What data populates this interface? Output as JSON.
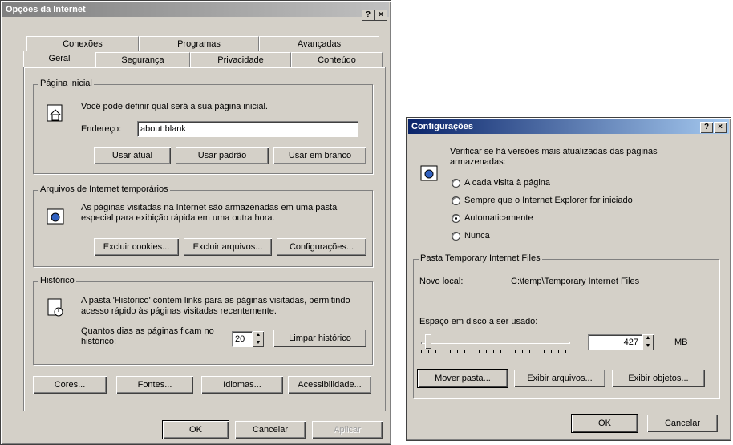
{
  "left_window": {
    "title": "Opções da Internet",
    "title_help": "?",
    "title_close": "×",
    "tabs_row1": [
      "Conexões",
      "Programas",
      "Avançadas"
    ],
    "tabs_row2": [
      "Geral",
      "Segurança",
      "Privacidade",
      "Conteúdo"
    ],
    "home": {
      "label": "Página inicial",
      "desc": "Você pode definir qual será a sua página inicial.",
      "address_label": "Endereço:",
      "address_value": "about:blank",
      "btn_current": "Usar atual",
      "btn_default": "Usar padrão",
      "btn_blank": "Usar em branco"
    },
    "temp": {
      "label": "Arquivos de Internet temporários",
      "desc": "As páginas visitadas na Internet são armazenadas em uma pasta especial para exibição rápida em uma outra hora.",
      "btn_cookies": "Excluir cookies...",
      "btn_files": "Excluir arquivos...",
      "btn_settings": "Configurações..."
    },
    "history": {
      "label": "Histórico",
      "desc": "A pasta 'Histórico' contém links para as páginas visitadas, permitindo acesso rápido às páginas visitadas recentemente.",
      "days_label": "Quantos dias as páginas ficam no histórico:",
      "days_value": "20",
      "btn_clear": "Limpar histórico"
    },
    "bottom_buttons": [
      "Cores...",
      "Fontes...",
      "Idiomas...",
      "Acessibilidade..."
    ],
    "ok": "OK",
    "cancel": "Cancelar",
    "apply": "Aplicar"
  },
  "right_window": {
    "title": "Configurações",
    "title_help": "?",
    "title_close": "×",
    "check_label": "Verificar se há versões mais atualizadas das páginas armazenadas:",
    "options": [
      "A cada visita à página",
      "Sempre que o Internet Explorer for iniciado",
      "Automaticamente",
      "Nunca"
    ],
    "selected_option": 2,
    "folder_group_label": "Pasta Temporary Internet Files",
    "location_label": "Novo local:",
    "location_value": "C:\\temp\\Temporary Internet Files",
    "disk_label": "Espaço em disco a ser usado:",
    "disk_value": "427",
    "disk_unit": "MB",
    "slider_fraction": 0.03,
    "btn_move": "Mover pasta...",
    "btn_view_files": "Exibir arquivos...",
    "btn_view_objects": "Exibir objetos...",
    "ok": "OK",
    "cancel": "Cancelar"
  }
}
